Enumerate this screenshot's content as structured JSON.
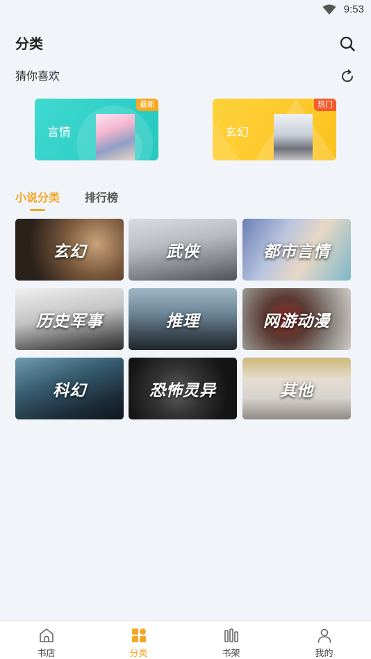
{
  "status_bar": {
    "time": "9:53"
  },
  "header": {
    "title": "分类"
  },
  "guess": {
    "label": "猜你喜欢"
  },
  "recommend": [
    {
      "name": "言情",
      "badge": "最新"
    },
    {
      "name": "玄幻",
      "badge": "热门"
    }
  ],
  "tabs": [
    {
      "label": "小说分类",
      "active": true
    },
    {
      "label": "排行榜",
      "active": false
    }
  ],
  "categories": [
    {
      "label": "玄幻"
    },
    {
      "label": "武侠"
    },
    {
      "label": "都市言情"
    },
    {
      "label": "历史军事"
    },
    {
      "label": "推理"
    },
    {
      "label": "网游动漫"
    },
    {
      "label": "科幻"
    },
    {
      "label": "恐怖灵异"
    },
    {
      "label": "其他"
    }
  ],
  "bottom_nav": [
    {
      "label": "书店",
      "icon": "home-icon",
      "active": false
    },
    {
      "label": "分类",
      "icon": "grid-icon",
      "active": true
    },
    {
      "label": "书架",
      "icon": "bookshelf-icon",
      "active": false
    },
    {
      "label": "我的",
      "icon": "user-icon",
      "active": false
    }
  ],
  "colors": {
    "accent": "#f5a623",
    "background": "#f1f4f8"
  }
}
